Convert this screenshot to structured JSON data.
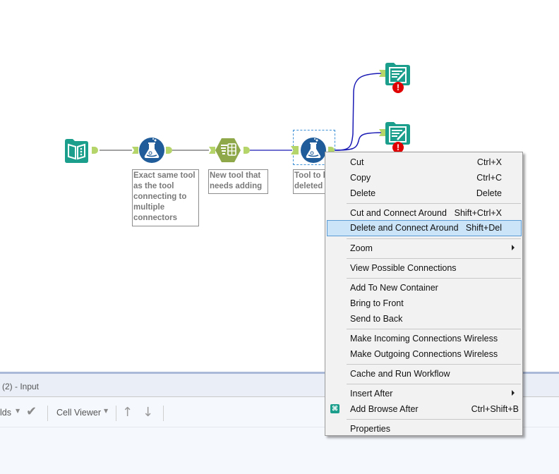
{
  "canvas": {
    "tools": [
      {
        "name": "input-data-tool",
        "icon": "book-icon",
        "color": "#1c9e8c"
      },
      {
        "name": "formula-tool-1",
        "icon": "flask-icon",
        "color": "#1f5c99",
        "annotation": "Exact same tool\nas the tool\nconnecting to\nmultiple\nconnectors"
      },
      {
        "name": "select-tool",
        "icon": "table-icon",
        "color": "#8fa94a",
        "annotation": "New tool that\nneeds adding"
      },
      {
        "name": "formula-tool-2",
        "icon": "flask-icon",
        "color": "#1f5c99",
        "annotation": "Tool to b\ndeleted",
        "selected": true
      },
      {
        "name": "output-data-tool-1",
        "icon": "output-icon",
        "color": "#1c9e8c",
        "error": true
      },
      {
        "name": "output-data-tool-2",
        "icon": "output-icon",
        "color": "#1c9e8c",
        "error": true
      }
    ],
    "colors": {
      "wire_default": "#444444",
      "wire_selected": "#1a1ab5",
      "anchor": "#b5d46a",
      "error": "#e00000"
    }
  },
  "context_menu": {
    "items": [
      {
        "label": "Cut",
        "shortcut": "Ctrl+X"
      },
      {
        "label": "Copy",
        "shortcut": "Ctrl+C"
      },
      {
        "label": "Delete",
        "shortcut": "Delete"
      },
      {
        "label": "Cut and Connect Around",
        "shortcut": "Shift+Ctrl+X"
      },
      {
        "label": "Delete and Connect Around",
        "shortcut": "Shift+Del",
        "highlighted": true
      },
      {
        "label": "Zoom",
        "submenu": true
      },
      {
        "label": "View Possible Connections"
      },
      {
        "label": "Add To New Container"
      },
      {
        "label": "Bring to Front"
      },
      {
        "label": "Send to Back"
      },
      {
        "label": "Make Incoming Connections Wireless"
      },
      {
        "label": "Make Outgoing Connections Wireless"
      },
      {
        "label": "Cache and Run Workflow"
      },
      {
        "label": "Insert After",
        "submenu": true
      },
      {
        "label": "Add Browse After",
        "shortcut": "Ctrl+Shift+B",
        "icon": "binoculars-icon"
      },
      {
        "label": "Properties"
      }
    ]
  },
  "results_panel": {
    "title": "(2) - Input",
    "toolbar": {
      "fields_label": "lds",
      "cell_viewer_label": "Cell Viewer"
    }
  }
}
